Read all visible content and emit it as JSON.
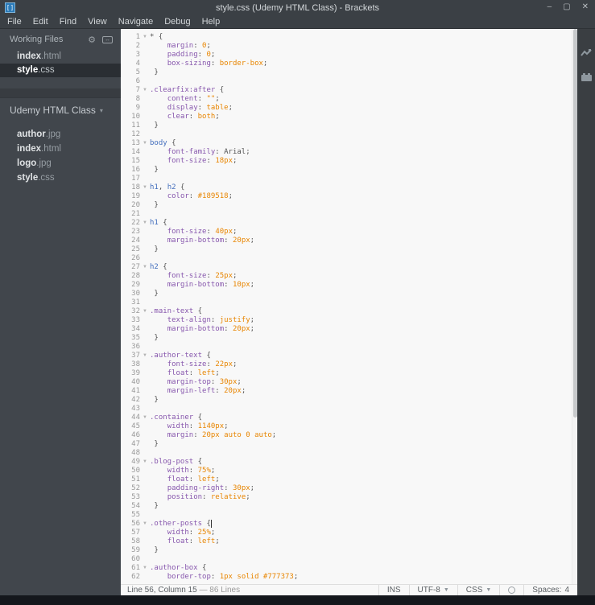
{
  "window": {
    "title": "style.css (Udemy HTML Class) - Brackets",
    "logo_glyph": "[]",
    "controls": {
      "minimize": "–",
      "maximize": "▢",
      "close": "✕"
    }
  },
  "menu": {
    "items": [
      "File",
      "Edit",
      "Find",
      "View",
      "Navigate",
      "Debug",
      "Help"
    ]
  },
  "sidebar": {
    "working_files": {
      "title": "Working Files",
      "files": [
        {
          "name": "index",
          "ext": ".html",
          "selected": false
        },
        {
          "name": "style",
          "ext": ".css",
          "selected": true
        }
      ]
    },
    "project": {
      "name": "Udemy HTML Class",
      "caret": "▾",
      "files": [
        {
          "name": "author",
          "ext": ".jpg"
        },
        {
          "name": "index",
          "ext": ".html"
        },
        {
          "name": "logo",
          "ext": ".jpg"
        },
        {
          "name": "style",
          "ext": ".css"
        }
      ]
    }
  },
  "editor": {
    "fold_glyph": "▼",
    "lines": [
      {
        "f": 1,
        "tk": [
          [
            "p",
            "* {"
          ]
        ]
      },
      {
        "tk": [
          [
            "p",
            "    "
          ],
          [
            "pr",
            "margin"
          ],
          [
            "p",
            ": "
          ],
          [
            "v",
            "0"
          ],
          [
            "p",
            ";"
          ]
        ]
      },
      {
        "tk": [
          [
            "p",
            "    "
          ],
          [
            "pr",
            "padding"
          ],
          [
            "p",
            ": "
          ],
          [
            "v",
            "0"
          ],
          [
            "p",
            ";"
          ]
        ]
      },
      {
        "tk": [
          [
            "p",
            "    "
          ],
          [
            "pr",
            "box-sizing"
          ],
          [
            "p",
            ": "
          ],
          [
            "v",
            "border-box"
          ],
          [
            "p",
            ";"
          ]
        ]
      },
      {
        "tk": [
          [
            "p",
            " }"
          ]
        ]
      },
      {
        "tk": []
      },
      {
        "f": 1,
        "tk": [
          [
            "q",
            ".clearfix:after"
          ],
          [
            "p",
            " {"
          ]
        ]
      },
      {
        "tk": [
          [
            "p",
            "    "
          ],
          [
            "pr",
            "content"
          ],
          [
            "p",
            ": "
          ],
          [
            "v",
            "\"\""
          ],
          [
            "p",
            ";"
          ]
        ]
      },
      {
        "tk": [
          [
            "p",
            "    "
          ],
          [
            "pr",
            "display"
          ],
          [
            "p",
            ": "
          ],
          [
            "v",
            "table"
          ],
          [
            "p",
            ";"
          ]
        ]
      },
      {
        "tk": [
          [
            "p",
            "    "
          ],
          [
            "pr",
            "clear"
          ],
          [
            "p",
            ": "
          ],
          [
            "v",
            "both"
          ],
          [
            "p",
            ";"
          ]
        ]
      },
      {
        "tk": [
          [
            "p",
            " }"
          ]
        ]
      },
      {
        "tk": []
      },
      {
        "f": 1,
        "tk": [
          [
            "t",
            "body"
          ],
          [
            "p",
            " {"
          ]
        ]
      },
      {
        "tk": [
          [
            "p",
            "    "
          ],
          [
            "pr",
            "font-family"
          ],
          [
            "p",
            ": Arial;"
          ]
        ]
      },
      {
        "tk": [
          [
            "p",
            "    "
          ],
          [
            "pr",
            "font-size"
          ],
          [
            "p",
            ": "
          ],
          [
            "v",
            "18px"
          ],
          [
            "p",
            ";"
          ]
        ]
      },
      {
        "tk": [
          [
            "p",
            " }"
          ]
        ]
      },
      {
        "tk": []
      },
      {
        "f": 1,
        "tk": [
          [
            "t",
            "h1"
          ],
          [
            "p",
            ", "
          ],
          [
            "t",
            "h2"
          ],
          [
            "p",
            " {"
          ]
        ]
      },
      {
        "tk": [
          [
            "p",
            "    "
          ],
          [
            "pr",
            "color"
          ],
          [
            "p",
            ": "
          ],
          [
            "v",
            "#189518"
          ],
          [
            "p",
            ";"
          ]
        ]
      },
      {
        "tk": [
          [
            "p",
            " }"
          ]
        ]
      },
      {
        "tk": []
      },
      {
        "f": 1,
        "tk": [
          [
            "t",
            "h1"
          ],
          [
            "p",
            " {"
          ]
        ]
      },
      {
        "tk": [
          [
            "p",
            "    "
          ],
          [
            "pr",
            "font-size"
          ],
          [
            "p",
            ": "
          ],
          [
            "v",
            "40px"
          ],
          [
            "p",
            ";"
          ]
        ]
      },
      {
        "tk": [
          [
            "p",
            "    "
          ],
          [
            "pr",
            "margin-bottom"
          ],
          [
            "p",
            ": "
          ],
          [
            "v",
            "20px"
          ],
          [
            "p",
            ";"
          ]
        ]
      },
      {
        "tk": [
          [
            "p",
            " }"
          ]
        ]
      },
      {
        "tk": []
      },
      {
        "f": 1,
        "tk": [
          [
            "t",
            "h2"
          ],
          [
            "p",
            " {"
          ]
        ]
      },
      {
        "tk": [
          [
            "p",
            "    "
          ],
          [
            "pr",
            "font-size"
          ],
          [
            "p",
            ": "
          ],
          [
            "v",
            "25px"
          ],
          [
            "p",
            ";"
          ]
        ]
      },
      {
        "tk": [
          [
            "p",
            "    "
          ],
          [
            "pr",
            "margin-bottom"
          ],
          [
            "p",
            ": "
          ],
          [
            "v",
            "10px"
          ],
          [
            "p",
            ";"
          ]
        ]
      },
      {
        "tk": [
          [
            "p",
            " }"
          ]
        ]
      },
      {
        "tk": []
      },
      {
        "f": 1,
        "tk": [
          [
            "q",
            ".main-text"
          ],
          [
            "p",
            " {"
          ]
        ]
      },
      {
        "tk": [
          [
            "p",
            "    "
          ],
          [
            "pr",
            "text-align"
          ],
          [
            "p",
            ": "
          ],
          [
            "v",
            "justify"
          ],
          [
            "p",
            ";"
          ]
        ]
      },
      {
        "tk": [
          [
            "p",
            "    "
          ],
          [
            "pr",
            "margin-bottom"
          ],
          [
            "p",
            ": "
          ],
          [
            "v",
            "20px"
          ],
          [
            "p",
            ";"
          ]
        ]
      },
      {
        "tk": [
          [
            "p",
            " }"
          ]
        ]
      },
      {
        "tk": []
      },
      {
        "f": 1,
        "tk": [
          [
            "q",
            ".author-text"
          ],
          [
            "p",
            " {"
          ]
        ]
      },
      {
        "tk": [
          [
            "p",
            "    "
          ],
          [
            "pr",
            "font-size"
          ],
          [
            "p",
            ": "
          ],
          [
            "v",
            "22px"
          ],
          [
            "p",
            ";"
          ]
        ]
      },
      {
        "tk": [
          [
            "p",
            "    "
          ],
          [
            "pr",
            "float"
          ],
          [
            "p",
            ": "
          ],
          [
            "v",
            "left"
          ],
          [
            "p",
            ";"
          ]
        ]
      },
      {
        "tk": [
          [
            "p",
            "    "
          ],
          [
            "pr",
            "margin-top"
          ],
          [
            "p",
            ": "
          ],
          [
            "v",
            "30px"
          ],
          [
            "p",
            ";"
          ]
        ]
      },
      {
        "tk": [
          [
            "p",
            "    "
          ],
          [
            "pr",
            "margin-left"
          ],
          [
            "p",
            ": "
          ],
          [
            "v",
            "20px"
          ],
          [
            "p",
            ";"
          ]
        ]
      },
      {
        "tk": [
          [
            "p",
            " }"
          ]
        ]
      },
      {
        "tk": []
      },
      {
        "f": 1,
        "tk": [
          [
            "q",
            ".container"
          ],
          [
            "p",
            " {"
          ]
        ]
      },
      {
        "tk": [
          [
            "p",
            "    "
          ],
          [
            "pr",
            "width"
          ],
          [
            "p",
            ": "
          ],
          [
            "v",
            "1140px"
          ],
          [
            "p",
            ";"
          ]
        ]
      },
      {
        "tk": [
          [
            "p",
            "    "
          ],
          [
            "pr",
            "margin"
          ],
          [
            "p",
            ": "
          ],
          [
            "v",
            "20px"
          ],
          [
            "p",
            " "
          ],
          [
            "v",
            "auto"
          ],
          [
            "p",
            " "
          ],
          [
            "v",
            "0"
          ],
          [
            "p",
            " "
          ],
          [
            "v",
            "auto"
          ],
          [
            "p",
            ";"
          ]
        ]
      },
      {
        "tk": [
          [
            "p",
            " }"
          ]
        ]
      },
      {
        "tk": []
      },
      {
        "f": 1,
        "tk": [
          [
            "q",
            ".blog-post"
          ],
          [
            "p",
            " {"
          ]
        ]
      },
      {
        "tk": [
          [
            "p",
            "    "
          ],
          [
            "pr",
            "width"
          ],
          [
            "p",
            ": "
          ],
          [
            "v",
            "75%"
          ],
          [
            "p",
            ";"
          ]
        ]
      },
      {
        "tk": [
          [
            "p",
            "    "
          ],
          [
            "pr",
            "float"
          ],
          [
            "p",
            ": "
          ],
          [
            "v",
            "left"
          ],
          [
            "p",
            ";"
          ]
        ]
      },
      {
        "tk": [
          [
            "p",
            "    "
          ],
          [
            "pr",
            "padding-right"
          ],
          [
            "p",
            ": "
          ],
          [
            "v",
            "30px"
          ],
          [
            "p",
            ";"
          ]
        ]
      },
      {
        "tk": [
          [
            "p",
            "    "
          ],
          [
            "pr",
            "position"
          ],
          [
            "p",
            ": "
          ],
          [
            "v",
            "relative"
          ],
          [
            "p",
            ";"
          ]
        ]
      },
      {
        "tk": [
          [
            "p",
            " }"
          ]
        ]
      },
      {
        "tk": []
      },
      {
        "f": 1,
        "cursor": 1,
        "tk": [
          [
            "q",
            ".other-posts"
          ],
          [
            "p",
            " {"
          ]
        ]
      },
      {
        "tk": [
          [
            "p",
            "    "
          ],
          [
            "pr",
            "width"
          ],
          [
            "p",
            ": "
          ],
          [
            "v",
            "25%"
          ],
          [
            "p",
            ";"
          ]
        ]
      },
      {
        "tk": [
          [
            "p",
            "    "
          ],
          [
            "pr",
            "float"
          ],
          [
            "p",
            ": "
          ],
          [
            "v",
            "left"
          ],
          [
            "p",
            ";"
          ]
        ]
      },
      {
        "tk": [
          [
            "p",
            " }"
          ]
        ]
      },
      {
        "tk": []
      },
      {
        "f": 1,
        "tk": [
          [
            "q",
            ".author-box"
          ],
          [
            "p",
            " {"
          ]
        ]
      },
      {
        "tk": [
          [
            "p",
            "    "
          ],
          [
            "pr",
            "border-top"
          ],
          [
            "p",
            ": "
          ],
          [
            "v",
            "1px"
          ],
          [
            "p",
            " "
          ],
          [
            "v",
            "solid"
          ],
          [
            "p",
            " "
          ],
          [
            "v",
            "#777373"
          ],
          [
            "p",
            ";"
          ]
        ]
      }
    ]
  },
  "status": {
    "position": "Line 56, Column 15",
    "lines_info": "— 86 Lines",
    "overwrite": "INS",
    "encoding": "UTF-8",
    "language": "CSS",
    "indent": "Spaces:",
    "indent_size": "4"
  },
  "theme": {
    "chrome_bg": "#3b4045",
    "sidebar_bg": "#41464c",
    "sidebar_selected_bg": "#2a2e33",
    "editor_bg": "#f8f8f8",
    "tag_blue": "#446fbd",
    "selector_property_purple": "#8757ad",
    "value_orange": "#e88501",
    "plain_text": "#535353",
    "line_number_gray": "#989898",
    "brand_blue": "#2a7ab8"
  }
}
